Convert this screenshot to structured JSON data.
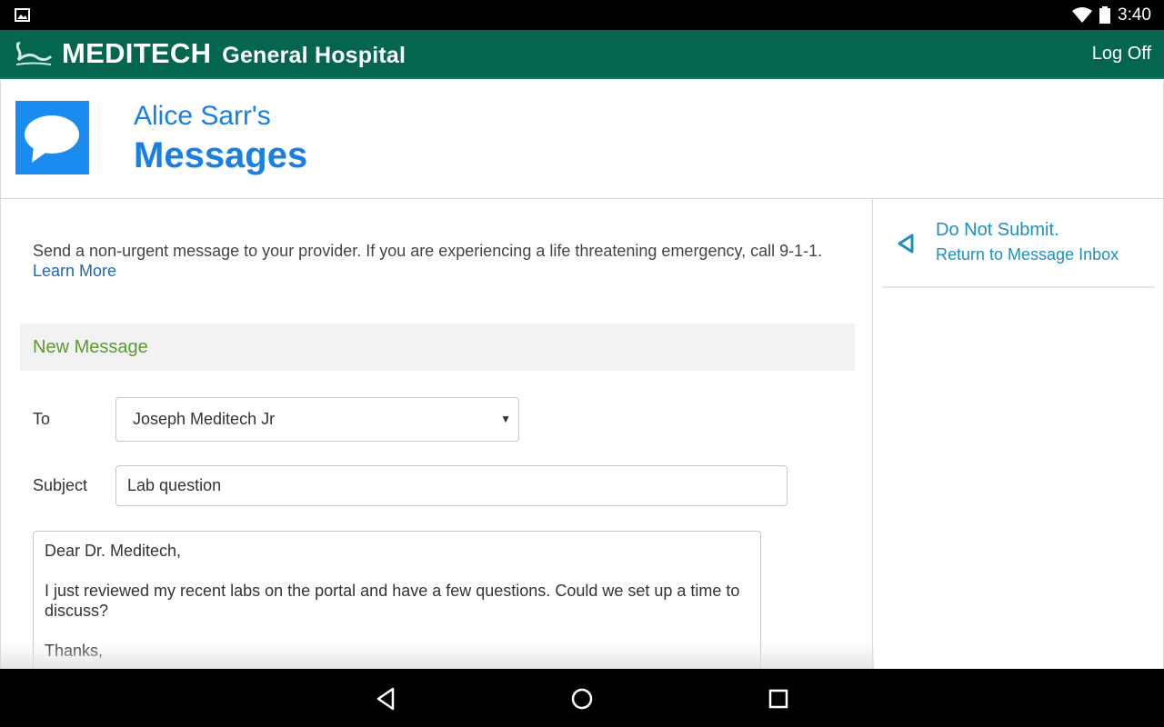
{
  "status_bar": {
    "time": "3:40"
  },
  "header": {
    "brand": "MEDITECH",
    "subbrand": "General Hospital",
    "logoff_label": "Log Off"
  },
  "page": {
    "owner": "Alice Sarr's",
    "title": "Messages"
  },
  "notice": {
    "text": "Send a non-urgent message to your provider. If you are experiencing a life threatening emergency, call 9-1-1.",
    "link_label": "Learn More"
  },
  "form": {
    "section_title": "New Message",
    "to_label": "To",
    "to_value": "Joseph Meditech Jr",
    "subject_label": "Subject",
    "subject_value": "Lab question",
    "body_value": "Dear Dr. Meditech,\n\nI just reviewed my recent labs on the portal and have a few questions. Could we set up a time to discuss?\n\nThanks,"
  },
  "sidebar": {
    "title": "Do Not Submit.",
    "subtitle": "Return to Message Inbox"
  },
  "colors": {
    "header_green": "#05664f",
    "accent_blue": "#1a7fe3",
    "section_green": "#5a9a2f",
    "link_teal": "#1f8fc2"
  }
}
